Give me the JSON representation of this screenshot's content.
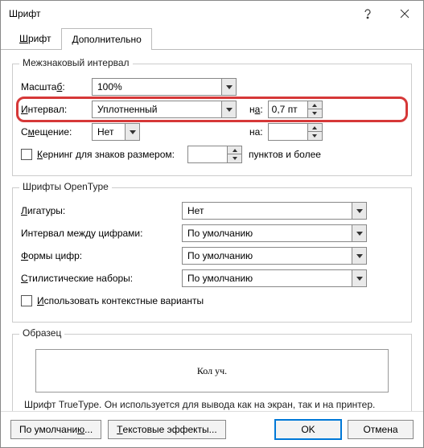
{
  "title": "Шрифт",
  "tabs": {
    "font": "Шрифт",
    "advanced": "Дополнительно"
  },
  "spacing": {
    "legend": "Межзнаковый интервал",
    "scale_label": "Масштаб:",
    "scale_value": "100%",
    "spacing_label": "Интервал:",
    "spacing_value": "Уплотненный",
    "by_label": "на:",
    "by_value": "0,7 пт",
    "position_label": "Смещение:",
    "position_value": "Нет",
    "position_by_label": "на:",
    "position_by_value": "",
    "kerning_label": "Кернинг для знаков размером:",
    "kerning_value": "",
    "kerning_suffix": "пунктов и более"
  },
  "opentype": {
    "legend": "Шрифты OpenType",
    "ligatures_label": "Лигатуры:",
    "ligatures_value": "Нет",
    "numspacing_label": "Интервал между цифрами:",
    "numspacing_value": "По умолчанию",
    "numforms_label": "Формы цифр:",
    "numforms_value": "По умолчанию",
    "stylistic_label": "Стилистические наборы:",
    "stylistic_value": "По умолчанию",
    "contextual_label": "Использовать контекстные варианты"
  },
  "sample": {
    "legend": "Образец",
    "text": "Кол уч."
  },
  "hint": "Шрифт TrueType. Он используется для вывода как на экран, так и на принтер.",
  "footer": {
    "default": "По умолчанию...",
    "text_effects": "Текстовые эффекты...",
    "ok": "OK",
    "cancel": "Отмена"
  }
}
